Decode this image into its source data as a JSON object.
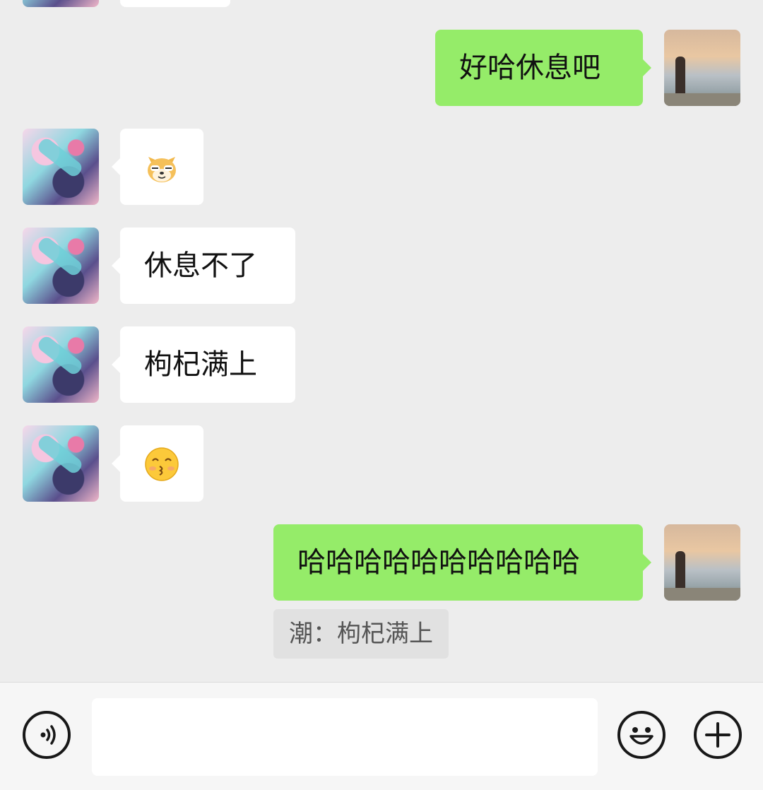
{
  "chat": {
    "messages": [
      {
        "direction": "outgoing",
        "text": "好哈休息吧"
      },
      {
        "direction": "incoming",
        "type": "emoji",
        "emoji": "doge-cat-emoji"
      },
      {
        "direction": "incoming",
        "text": "休息不了"
      },
      {
        "direction": "incoming",
        "text": "枸杞满上"
      },
      {
        "direction": "incoming",
        "type": "emoji",
        "emoji": "kiss-face-emoji"
      },
      {
        "direction": "outgoing",
        "text": "哈哈哈哈哈哈哈哈哈哈"
      }
    ],
    "quote": "潮：枸杞满上"
  },
  "input_bar": {
    "voice_icon": "voice-icon",
    "emoji_icon": "smiley-icon",
    "more_icon": "plus-icon",
    "text_value": ""
  },
  "colors": {
    "background": "#ededed",
    "outgoing_bubble": "#95ec69",
    "incoming_bubble": "#ffffff",
    "quote_bg": "#e1e1e1"
  }
}
